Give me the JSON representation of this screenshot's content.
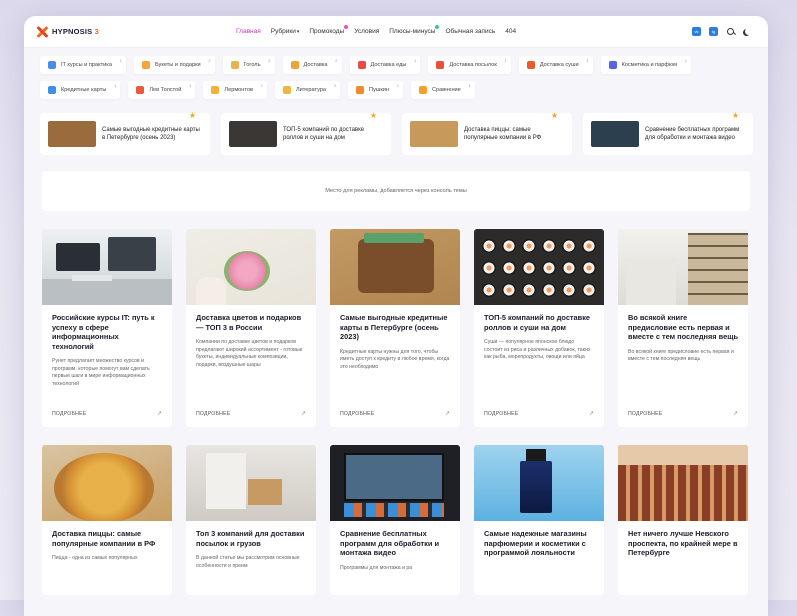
{
  "brand": {
    "name": "HYPNOSIS",
    "version": "3"
  },
  "nav": [
    {
      "label": "Главная",
      "active": true
    },
    {
      "label": "Рубрики",
      "caret": true
    },
    {
      "label": "Промокоды",
      "dot": "pink"
    },
    {
      "label": "Условия"
    },
    {
      "label": "Плюсы-минусы",
      "dot": "green"
    },
    {
      "label": "Обычная запись"
    },
    {
      "label": "404"
    }
  ],
  "social": [
    {
      "label": "vk"
    },
    {
      "label": "tg"
    }
  ],
  "tags": [
    {
      "label": "IT курсы и практика",
      "count": "1",
      "color": "#4a8de8"
    },
    {
      "label": "Букеты и подарки",
      "count": "2",
      "color": "#f3a43b"
    },
    {
      "label": "Гоголь",
      "count": "2",
      "color": "#e9b14f"
    },
    {
      "label": "Доставка",
      "count": "2",
      "color": "#f0a23c"
    },
    {
      "label": "Доставка еды",
      "count": "1",
      "color": "#e84a4a"
    },
    {
      "label": "Доставка посылок",
      "count": "1",
      "color": "#e8503a"
    },
    {
      "label": "Доставка суши",
      "count": "1",
      "color": "#ea5b2c"
    },
    {
      "label": "Косметика и парфюм",
      "count": "1",
      "color": "#5865e0"
    },
    {
      "label": "Кредитные карты",
      "count": "1",
      "color": "#3f8fe6"
    },
    {
      "label": "Лев Толстой",
      "count": "1",
      "color": "#e85a3a"
    },
    {
      "label": "Лермонтов",
      "count": "1",
      "color": "#f2b23a"
    },
    {
      "label": "Литература",
      "count": "2",
      "color": "#f0b640"
    },
    {
      "label": "Пушкин",
      "count": "1",
      "color": "#f08a2c"
    },
    {
      "label": "Сравнение",
      "count": "1",
      "color": "#f4a02e"
    }
  ],
  "featured": [
    {
      "title": "Самые выгодные кредитные карты в Петербурге (осень 2023)",
      "thumb": "#9a6b3d"
    },
    {
      "title": "ТОП-5 компаний по доставке роллов и суши на дом",
      "thumb": "#3a3735"
    },
    {
      "title": "Доставка пиццы: самые популярные компании в РФ",
      "thumb": "#c79a5c"
    },
    {
      "title": "Сравнение бесплатных программ для обработки и монтажа видео",
      "thumb": "#2b3f4f"
    }
  ],
  "ad_text": "Место для рекламы, добавляется через консоль темы",
  "more_label": "ПОДРОБНЕЕ",
  "cards_row1": [
    {
      "title": "Российские курсы IT: путь к успеху в сфере информационных технологий",
      "text": "Рунет предлагает множество курсов и программ, которые помогут вам сделать первые шаги в мире информационных технологий",
      "img": "img-it"
    },
    {
      "title": "Доставка цветов и подарков — ТОП 3 в России",
      "text": "Компании по доставке цветов и подарков предлагают широкий ассортимент - готовые букеты, индивидуальные композиции, подарки, воздушные шары",
      "img": "img-flowers"
    },
    {
      "title": "Самые выгодные кредитные карты в Петербурге (осень 2023)",
      "text": "Кредитные карты нужны для того, чтобы иметь доступ к кредиту в любое время, когда это необходимо",
      "img": "img-wallet"
    },
    {
      "title": "ТОП-5 компаний по доставке роллов и суши на дом",
      "text": "Суши — популярное японское блюдо состоит из риса и различных добавок, таких как рыба, морепродукты, овощи или яйца",
      "img": "img-sushi"
    },
    {
      "title": "Во всякой книге предисловие есть первая и вместе с тем последняя вещь",
      "text": "Во всякой книге предисловие есть первая и вместе с тем последняя вещь",
      "img": "img-library"
    }
  ],
  "cards_row2": [
    {
      "title": "Доставка пиццы: самые популярные компании в РФ",
      "text": "Пицца - одна из самых популярных",
      "img": "img-pizza"
    },
    {
      "title": "Топ 3 компаний для доставки посылок и грузов",
      "text": "В данной статье мы рассмотрим основные особенности и преим",
      "img": "img-boxes"
    },
    {
      "title": "Сравнение бесплатных программ для обработки и монтажа видео",
      "text": "Программы для монтажа и ра",
      "img": "img-video"
    },
    {
      "title": "Самые надежные магазины парфюмерии и косметики с программой лояльности",
      "text": "",
      "img": "img-perfume"
    },
    {
      "title": "Нет ничего лучше Невского проспекта, по крайней мере в Петербурге",
      "text": "",
      "img": "img-street"
    }
  ]
}
